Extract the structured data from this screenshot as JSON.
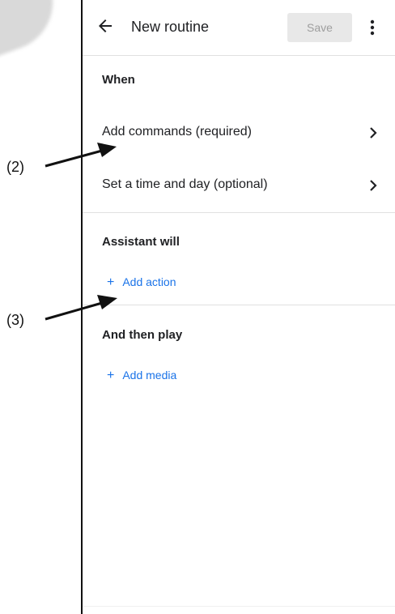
{
  "appbar": {
    "title": "New routine",
    "save_label": "Save",
    "back_icon": "arrow-back-icon",
    "more_icon": "more-vert-icon"
  },
  "when": {
    "title": "When",
    "rows": [
      {
        "label": "Add commands (required)"
      },
      {
        "label": "Set a time and day (optional)"
      }
    ]
  },
  "assistant": {
    "title": "Assistant will",
    "add_label": "Add action",
    "plus": "+"
  },
  "then_play": {
    "title": "And then play",
    "add_label": "Add media",
    "plus": "+"
  },
  "callouts": {
    "first": "(2)",
    "second": "(3)"
  },
  "colors": {
    "accent": "#1a73e8",
    "save_bg": "#e8e8e8",
    "save_text": "#9e9e9e"
  }
}
